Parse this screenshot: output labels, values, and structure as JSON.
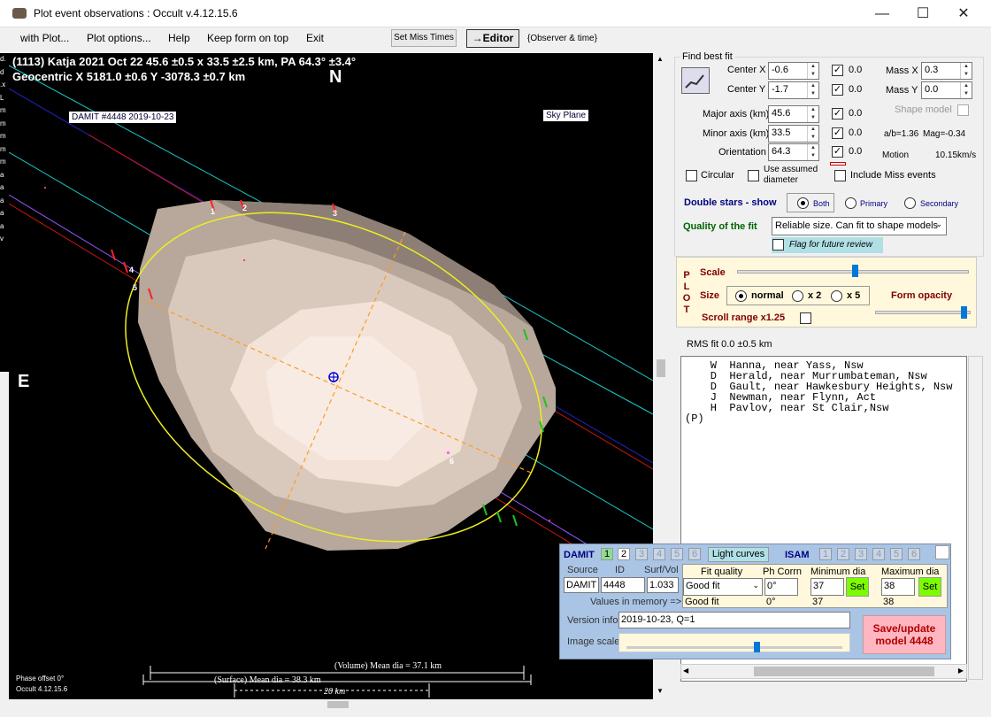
{
  "window": {
    "title": "Plot event observations : Occult v.4.12.15.6"
  },
  "menu": [
    "with Plot...",
    "Plot options...",
    "Help",
    "Keep form on top",
    "Exit"
  ],
  "toolbar": {
    "set_miss": "Set Miss Times",
    "editor": "→Editor",
    "observer_time": "{Observer & time}"
  },
  "plot": {
    "line1": "(1113) Katja  2021 Oct 22  45.6 ±0.5 x 33.5 ±2.5 km, PA 64.3° ±3.4°",
    "line2": "Geocentric  X  5181.0 ±0.6  Y -3078.3 ±0.7 km",
    "north": "N",
    "east": "E",
    "damit_label": "DAMIT #4448 2019-10-23",
    "sky_plane": "Sky Plane",
    "volume_dia": "(Volume) Mean dia = 37.1 km",
    "surface_dia": "(Surface) Mean dia = 38.3 km",
    "scale_km": "20 km",
    "phase_offset": "Phase offset 0°",
    "version": "Occult 4.12.15.6",
    "chord_labels": [
      "1",
      "2",
      "3",
      "4",
      "5",
      "6"
    ],
    "left_edge_letters": [
      "d.",
      "d",
      ".x",
      "L",
      "m",
      "m",
      "m",
      "m",
      "m",
      "a",
      "a",
      "a",
      "a",
      "a",
      "v"
    ]
  },
  "find": {
    "group": "Find best fit",
    "center_x": {
      "label": "Center X",
      "value": "-0.6",
      "check": "0.0"
    },
    "center_y": {
      "label": "Center Y",
      "value": "-1.7",
      "check": "0.0"
    },
    "major": {
      "label": "Major axis (km)",
      "value": "45.6",
      "check": "0.0"
    },
    "minor": {
      "label": "Minor axis (km)",
      "value": "33.5",
      "check": "0.0"
    },
    "orient": {
      "label": "Orientation",
      "value": "64.3",
      "check": "0.0"
    },
    "mass_x": {
      "label": "Mass X",
      "value": "0.3"
    },
    "mass_y": {
      "label": "Mass Y",
      "value": "0.0"
    },
    "shape_model": "Shape model",
    "ab": "a/b=1.36",
    "mag": "Mag=-0.34",
    "motion": "Motion",
    "motion_val": "10.15km/s",
    "circular": "Circular",
    "assumed": "Use assumed diameter",
    "include_miss": "Include Miss events",
    "double_stars": "Double stars - show",
    "both": "Both",
    "primary": "Primary",
    "secondary": "Secondary",
    "quality_label": "Quality of the fit",
    "quality_value": "Reliable size. Can fit to shape models",
    "flag": "Flag for future review"
  },
  "plotopts": {
    "plot_vertical": [
      "P",
      "L",
      "O",
      "T"
    ],
    "scale": "Scale",
    "size": "Size",
    "normal": "normal",
    "x2": "x 2",
    "x5": "x 5",
    "opacity": "Form opacity",
    "scroll": "Scroll range x1.25"
  },
  "rms": "RMS fit  0.0 ±0.5 km",
  "observers": "    W  Hanna, near Yass, Nsw\n    D  Herald, near Murrumbateman, Nsw\n    D  Gault, near Hawkesbury Heights, Nsw\n    J  Newman, near Flynn, Act\n    H  Pavlov, near St Clair,Nsw\n(P)",
  "damit": {
    "title": "DAMIT",
    "tabs": [
      "1",
      "2",
      "3",
      "4",
      "5",
      "6"
    ],
    "light_curves": "Light curves",
    "isam": "ISAM",
    "source_h": "Source",
    "id_h": "ID",
    "surf_h": "Surf/Vol",
    "source": "DAMIT",
    "id": "4448",
    "surf": "1.033",
    "fit_h": "Fit quality",
    "ph_h": "Ph Corrn",
    "min_h": "Minimum dia",
    "max_h": "Maximum dia",
    "fit": "Good fit",
    "ph": "0°",
    "min": "37",
    "max": "38",
    "set": "Set",
    "mem_label": "Values in memory =>",
    "mem_fit": "Good fit",
    "mem_ph": "0°",
    "mem_min": "37",
    "mem_max": "38",
    "version_label": "Version info",
    "version": "2019-10-23, Q=1",
    "image_scale": "Image scale",
    "save": "Save/update model 4448"
  }
}
